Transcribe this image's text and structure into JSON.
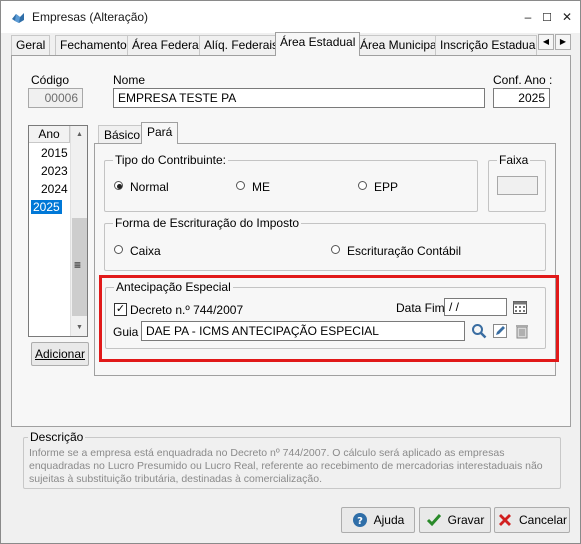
{
  "window": {
    "title": "Empresas (Alteração)",
    "minimize": "‒",
    "maximize": "☐",
    "close": "✕"
  },
  "tabs": [
    {
      "label": "Geral"
    },
    {
      "label": "Fechamento"
    },
    {
      "label": "Área Federal"
    },
    {
      "label": "Alíq. Federais"
    },
    {
      "label": "Área Estadual"
    },
    {
      "label": "Área Municipal"
    },
    {
      "label": "Inscrição Estadual S"
    }
  ],
  "tab_scroll": {
    "left": "◀",
    "right": "▶"
  },
  "header": {
    "codigo_label": "Código",
    "codigo_value": "00006",
    "nome_label": "Nome",
    "nome_value": "EMPRESA TESTE PA",
    "conf_ano_label": "Conf. Ano :",
    "conf_ano_value": "2025"
  },
  "years": {
    "column_header": "Ano",
    "items": [
      "2015",
      "2023",
      "2024",
      "2025"
    ],
    "selected": "2025",
    "add_button": "Adicionar",
    "scroll_grip": "≡",
    "scroll_up": "▲",
    "scroll_down": "▼"
  },
  "subtabs": [
    {
      "label": "Básico"
    },
    {
      "label": "Pará"
    }
  ],
  "tipo_contribuinte": {
    "legend": "Tipo do Contribuinte:",
    "options": [
      {
        "label": "Normal",
        "checked": true
      },
      {
        "label": "ME",
        "checked": false
      },
      {
        "label": "EPP",
        "checked": false
      }
    ]
  },
  "faixa": {
    "legend": "Faixa",
    "value": ""
  },
  "escrituracao": {
    "legend": "Forma de Escrituração do Imposto",
    "options": [
      {
        "label": "Caixa",
        "checked": false
      },
      {
        "label": "Escrituração Contábil",
        "checked": false
      }
    ]
  },
  "antecipacao": {
    "legend": "Antecipação Especial",
    "decreto_label": "Decreto n.º 744/2007",
    "decreto_checked": true,
    "check_mark": "✓",
    "data_fim_label": "Data Fim",
    "data_fim_value": " / /",
    "guia_label": "Guia",
    "guia_value": "DAE PA - ICMS ANTECIPAÇÃO ESPECIAL",
    "highlight_color": "#e11919"
  },
  "descricao": {
    "legend": "Descrição",
    "text": "Informe se a empresa está enquadrada no Decreto nº 744/2007. O cálculo será aplicado as empresas enquadradas no Lucro Presumido ou Lucro Real, referente ao recebimento de mercadorias interestaduais não sujeitas à substituição tributária, destinadas à comercialização."
  },
  "footer": {
    "ajuda": "Ajuda",
    "gravar": "Gravar",
    "cancelar": "Cancelar"
  },
  "colors": {
    "selection": "#0078d7",
    "window_bg": "#f0f0f0"
  }
}
